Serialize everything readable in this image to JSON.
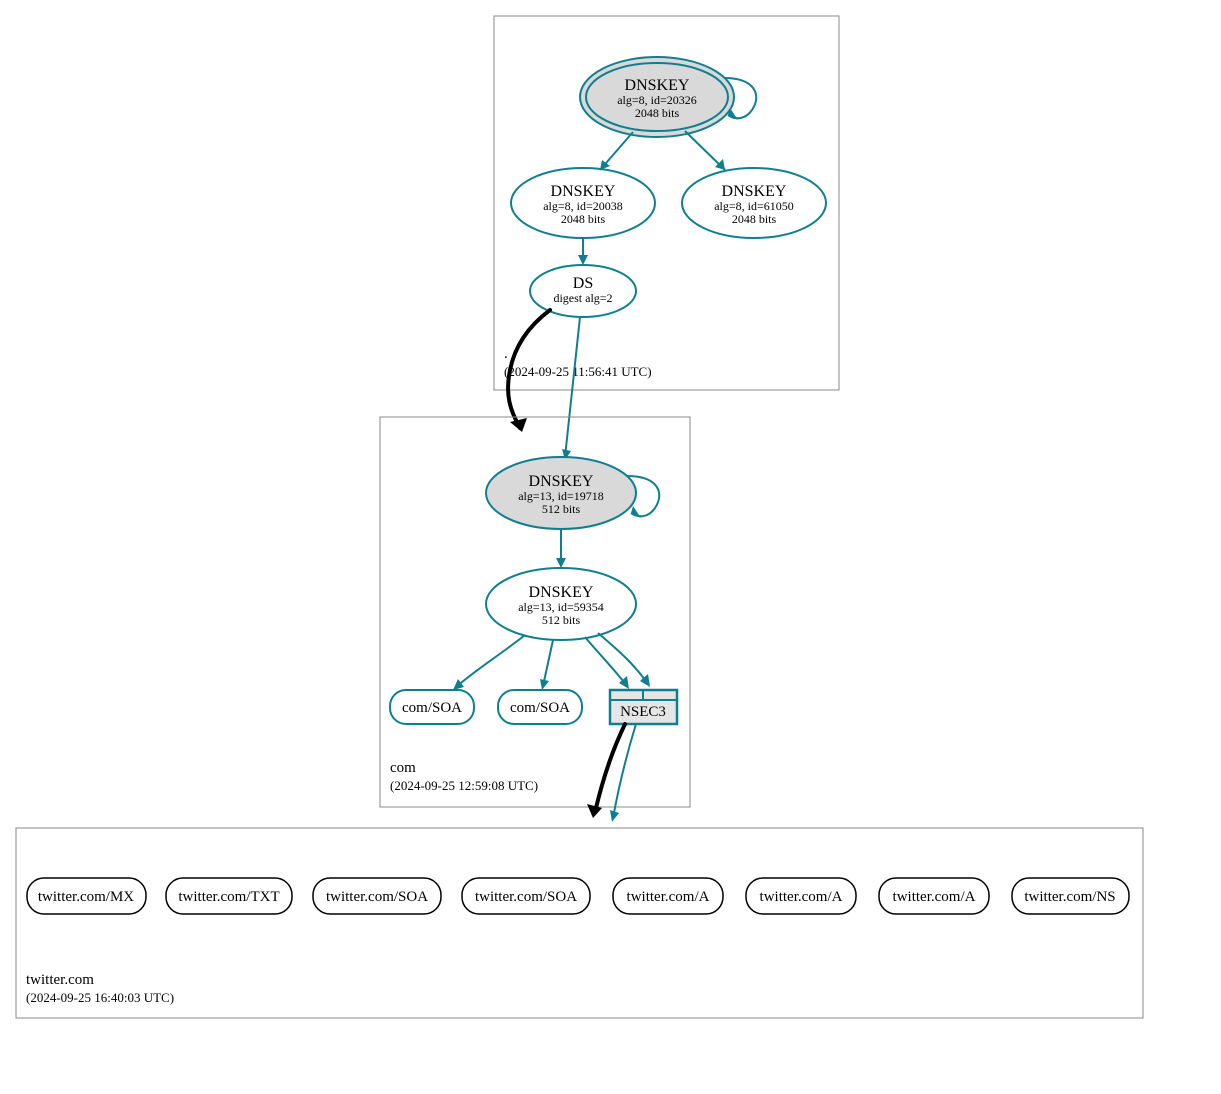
{
  "colors": {
    "teal": "#0f7f8f",
    "grey_fill": "#d9d9d9",
    "nsec3_fill": "#e6e6e6",
    "zone_border": "#888888"
  },
  "zones": {
    "root": {
      "name": ".",
      "timestamp": "(2024-09-25 11:56:41 UTC)",
      "nodes": {
        "ksk": {
          "title": "DNSKEY",
          "line2": "alg=8, id=20326",
          "line3": "2048 bits"
        },
        "zsk1": {
          "title": "DNSKEY",
          "line2": "alg=8, id=20038",
          "line3": "2048 bits"
        },
        "zsk2": {
          "title": "DNSKEY",
          "line2": "alg=8, id=61050",
          "line3": "2048 bits"
        },
        "ds": {
          "title": "DS",
          "line2": "digest alg=2"
        }
      }
    },
    "com": {
      "name": "com",
      "timestamp": "(2024-09-25 12:59:08 UTC)",
      "nodes": {
        "ksk": {
          "title": "DNSKEY",
          "line2": "alg=13, id=19718",
          "line3": "512 bits"
        },
        "zsk": {
          "title": "DNSKEY",
          "line2": "alg=13, id=59354",
          "line3": "512 bits"
        },
        "soa1": {
          "label": "com/SOA"
        },
        "soa2": {
          "label": "com/SOA"
        },
        "nsec3": {
          "label": "NSEC3"
        }
      }
    },
    "twitter": {
      "name": "twitter.com",
      "timestamp": "(2024-09-25 16:40:03 UTC)",
      "records": [
        {
          "label": "twitter.com/MX"
        },
        {
          "label": "twitter.com/TXT"
        },
        {
          "label": "twitter.com/SOA"
        },
        {
          "label": "twitter.com/SOA"
        },
        {
          "label": "twitter.com/A"
        },
        {
          "label": "twitter.com/A"
        },
        {
          "label": "twitter.com/A"
        },
        {
          "label": "twitter.com/NS"
        }
      ]
    }
  }
}
